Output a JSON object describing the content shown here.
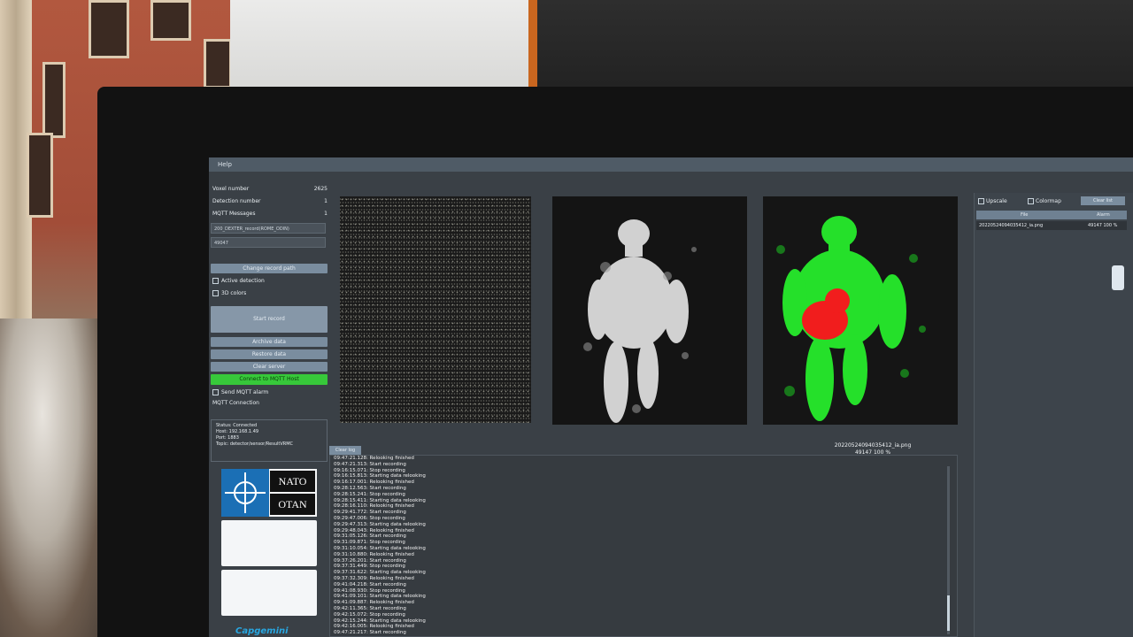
{
  "window": {
    "title": "Help"
  },
  "stats": [
    {
      "label": "Voxel number",
      "value": "2625"
    },
    {
      "label": "Detection number",
      "value": "1"
    },
    {
      "label": "MQTT Messages",
      "value": "1"
    }
  ],
  "record_path": "200_DEXTER_record(ROME_ODIN)",
  "record_id": "49047",
  "buttons": {
    "change_record_path": "Change record path",
    "start_record": "Start record",
    "archive_data": "Archive data",
    "restore_data": "Restore data",
    "clear_server": "Clear server",
    "connect_mqtt": "Connect to MQTT Host"
  },
  "checkboxes": {
    "active_detection": "Active detection",
    "3d_colors": "3D colors",
    "send_mqtt_alarm": "Send MQTT alarm"
  },
  "mqtt": {
    "title": "MQTT Connection",
    "status": "Status: Connected",
    "host": "Host: 192.168.1.49",
    "port": "Port: 1883",
    "topic": "Topic: detector/sensor/ResultVRMC"
  },
  "logos": {
    "nato_top": "NATO",
    "nato_bottom": "OTAN",
    "capgemini": "Capgemini"
  },
  "image_caption": {
    "filename": "20220524094035412_ia.png",
    "score": "49147 100 %"
  },
  "log": {
    "tab": "Clear log",
    "lines": [
      "09:47:21.128: Relooking finished",
      "09:47:21.313: Start recording",
      "09:16:15.071: Stop recording",
      "09:16:15.813: Starting data relooking",
      "09:16:17.001: Relooking finished",
      "09:28:12.563: Start recording",
      "09:28:15.241: Stop recording",
      "09:28:15.411: Starting data relooking",
      "09:28:16.110: Relooking finished",
      "09:29:41.772: Start recording",
      "09:29:47.006: Stop recording",
      "09:29:47.313: Starting data relooking",
      "09:29:48.043: Relooking finished",
      "09:31:05.126: Start recording",
      "09:31:09.871: Stop recording",
      "09:31:10.054: Starting data relooking",
      "09:31:10.880: Relooking finished",
      "09:37:26.201: Start recording",
      "09:37:31.449: Stop recording",
      "09:37:31.622: Starting data relooking",
      "09:37:32.309: Relooking finished",
      "09:41:04.218: Start recording",
      "09:41:08.930: Stop recording",
      "09:41:09.101: Starting data relooking",
      "09:41:09.887: Relooking finished",
      "09:42:11.365: Start recording",
      "09:42:15.072: Stop recording",
      "09:42:15.244: Starting data relooking",
      "09:42:16.005: Relooking finished",
      "09:47:21.217: Start recording"
    ]
  },
  "right_panel": {
    "upscale": "Upscale",
    "colormap": "Colormap",
    "clear_list": "Clear list",
    "col_file": "File",
    "col_alarm": "Alarm",
    "rows": [
      {
        "file": "20220524094035412_ia.png",
        "alarm": "49147 100 %"
      }
    ]
  }
}
